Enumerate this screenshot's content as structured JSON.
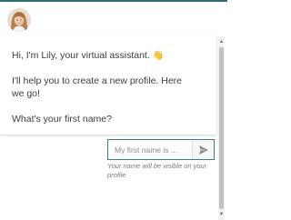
{
  "assistant": {
    "avatar_icon": "woman-portrait-avatar",
    "accent_color": "#2f6f73"
  },
  "messages": {
    "greeting": "Hi, I'm Lily, your virtual assistant.",
    "greeting_emoji": "👋",
    "intro": "I'll help you to create a new profile. Here we go!",
    "question": "What's your first name?"
  },
  "input": {
    "placeholder": "My first name is ...",
    "value": "",
    "send_icon": "paper-plane-icon",
    "hint": "Your name will be visible on your profile"
  },
  "scrollbar": {
    "up_icon": "scroll-up-arrow",
    "down_icon": "scroll-down-arrow"
  }
}
